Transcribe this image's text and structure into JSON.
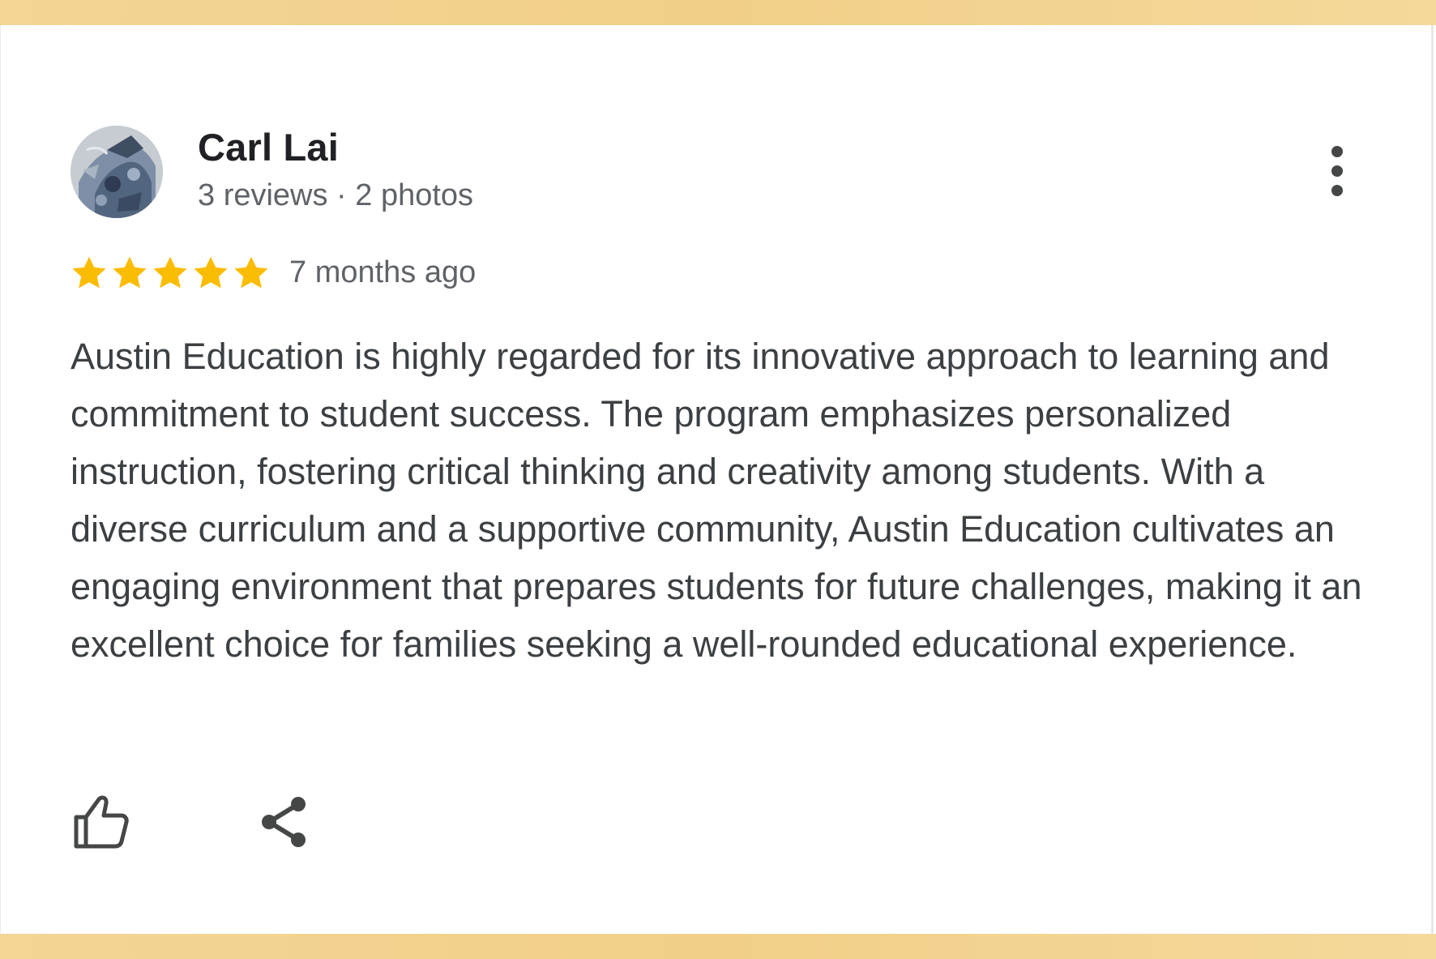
{
  "theme": {
    "band_gradient": [
      "#f3d594",
      "#f1cf88",
      "#f4d99b"
    ],
    "star_color": "#fbbc04",
    "icon_color": "#444746"
  },
  "review": {
    "author_name": "Carl Lai",
    "author_meta": "3 reviews · 2 photos",
    "rating": 5,
    "rating_max": 5,
    "time_ago": "7 months ago",
    "text": "Austin Education is highly regarded for its innovative approach to learning and commitment to student success. The program emphasizes personalized instruction, fostering critical thinking and creativity among students. With a diverse curriculum and a supportive community, Austin Education cultivates an engaging environment that prepares students for future challenges, making it an excellent choice for families seeking a well-rounded educational experience."
  },
  "icons": {
    "avatar": "avatar-photo",
    "more": "more-vert-icon",
    "star": "star-icon",
    "like": "thumbs-up-icon",
    "share": "share-icon"
  }
}
